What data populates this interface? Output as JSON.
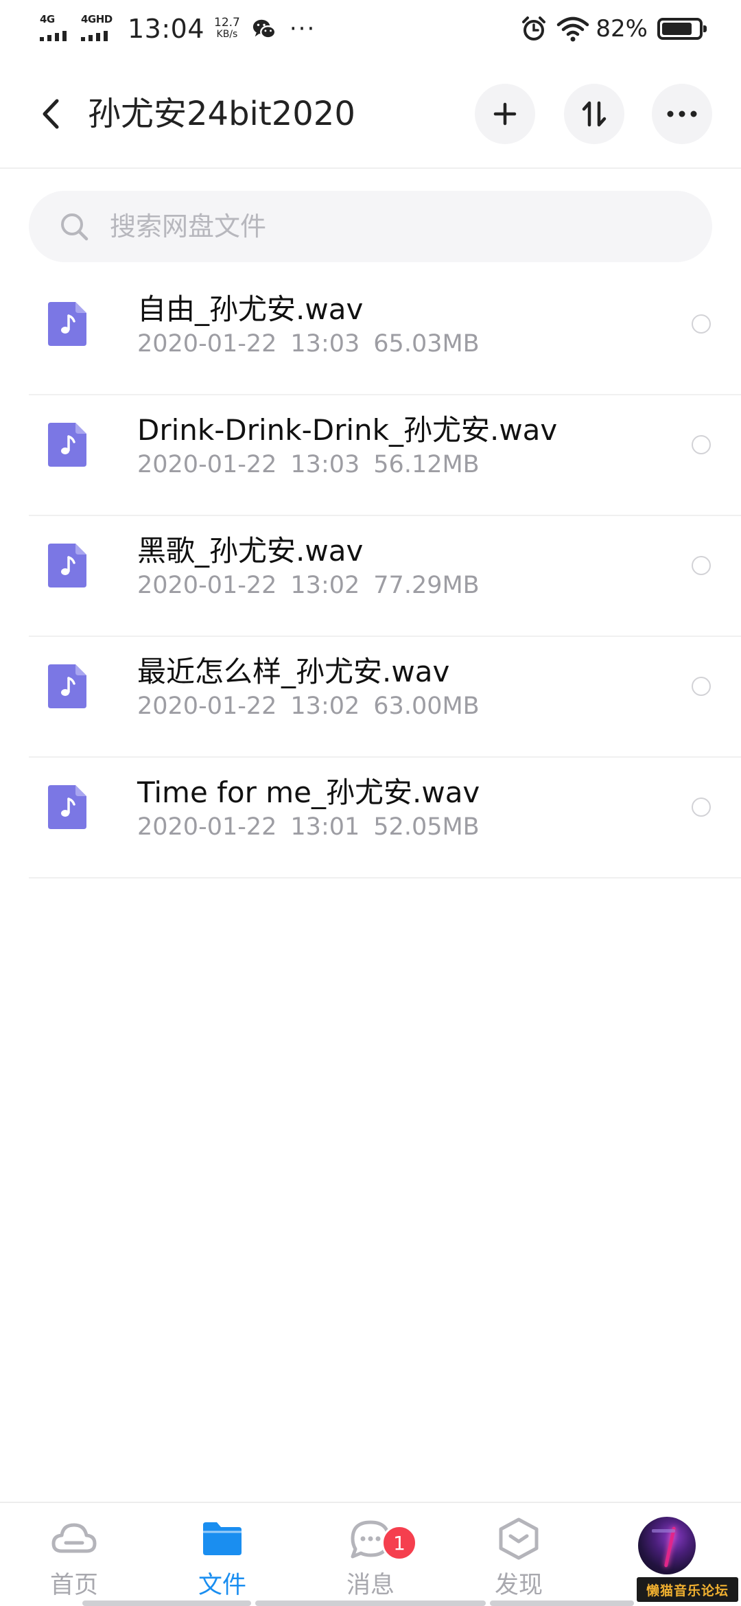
{
  "status_bar": {
    "network_1": "4G",
    "network_2": "4GHD",
    "time": "13:04",
    "speed_value": "12.7",
    "speed_unit": "KB/s",
    "notification_more": "···",
    "battery_percent": "82%",
    "battery_level": 0.82,
    "icons": [
      "signal-icon",
      "wechat-icon",
      "alarm-icon",
      "wifi-icon",
      "battery-icon"
    ]
  },
  "header": {
    "title": "孙尤安24bit2020",
    "icons": [
      "back-arrow-icon",
      "plus-icon",
      "sort-icon",
      "more-dots-icon"
    ]
  },
  "search": {
    "placeholder": "搜索网盘文件",
    "value": ""
  },
  "files": [
    {
      "name": "自由_孙尤安.wav",
      "date": "2020-01-22",
      "time": "13:03",
      "size": "65.03MB",
      "icon": "audio-file-icon"
    },
    {
      "name": "Drink-Drink-Drink_孙尤安.wav",
      "date": "2020-01-22",
      "time": "13:03",
      "size": "56.12MB",
      "icon": "audio-file-icon"
    },
    {
      "name": "黑歌_孙尤安.wav",
      "date": "2020-01-22",
      "time": "13:02",
      "size": "77.29MB",
      "icon": "audio-file-icon"
    },
    {
      "name": "最近怎么样_孙尤安.wav",
      "date": "2020-01-22",
      "time": "13:02",
      "size": "63.00MB",
      "icon": "audio-file-icon"
    },
    {
      "name": "Time for me_孙尤安.wav",
      "date": "2020-01-22",
      "time": "13:01",
      "size": "52.05MB",
      "icon": "audio-file-icon"
    }
  ],
  "bottom_nav": {
    "items": [
      {
        "label": "首页",
        "icon": "cloud-icon",
        "active": false
      },
      {
        "label": "文件",
        "icon": "folder-icon",
        "active": true
      },
      {
        "label": "消息",
        "icon": "chat-bubble-icon",
        "active": false,
        "badge": "1"
      },
      {
        "label": "发现",
        "icon": "discover-icon",
        "active": false
      }
    ],
    "avatar": "user-avatar"
  },
  "watermark": "懒猫音乐论坛",
  "colors": {
    "accent": "#1a8ef0",
    "file_icon": "#7b77e4",
    "badge": "#f53f4e",
    "meta_text": "#9d9da3",
    "nav_inactive": "#a8a8ae"
  }
}
